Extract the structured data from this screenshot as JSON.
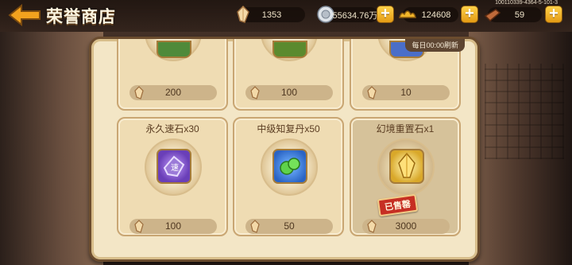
{
  "header": {
    "title": "荣誉商店",
    "server_id": "100110339-4364-5-101-3"
  },
  "resources": [
    {
      "name": "honor-gem",
      "value": "1353",
      "has_plus": false
    },
    {
      "name": "silver-coin",
      "value": "55634.76万",
      "has_plus": true
    },
    {
      "name": "gold-ingot",
      "value": "124608",
      "has_plus": true
    },
    {
      "name": "fuel-item",
      "value": "59",
      "has_plus": true
    }
  ],
  "shop": {
    "refresh_text": "每日00:00刷新",
    "top_row": [
      {
        "price": "200",
        "color": "#4f8a3a"
      },
      {
        "price": "100",
        "color": "#5b8a2e"
      },
      {
        "price": "10",
        "color": "#4a6ec8"
      }
    ],
    "items": [
      {
        "name": "永久速石x30",
        "price": "100",
        "icon": "purple-speed-stone-icon",
        "color": "#6a3fb8",
        "sold": false
      },
      {
        "name": "中级知复丹x50",
        "price": "50",
        "icon": "green-pill-icon",
        "color": "#2a64c4",
        "sold": false
      },
      {
        "name": "幻境重置石x1",
        "price": "3000",
        "icon": "golden-reset-stone-icon",
        "color": "#d9a82a",
        "sold": true,
        "sold_label": "已售罄"
      }
    ]
  }
}
